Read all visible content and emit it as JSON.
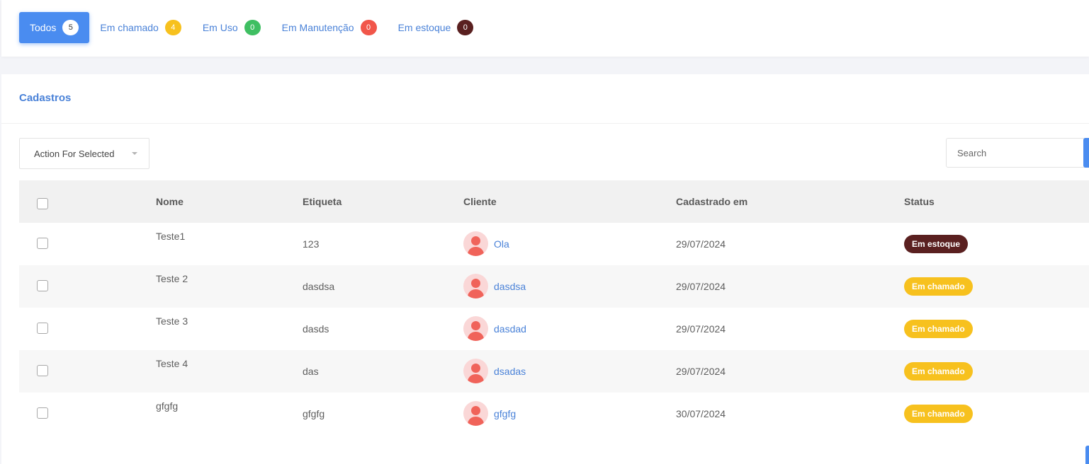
{
  "filters": [
    {
      "label": "Todos",
      "count": "5",
      "color": "#ffffff",
      "active": true
    },
    {
      "label": "Em chamado",
      "count": "4",
      "color": "#f7c11e"
    },
    {
      "label": "Em Uso",
      "count": "0",
      "color": "#3fbf62"
    },
    {
      "label": "Em Manutenção",
      "count": "0",
      "color": "#f1564a"
    },
    {
      "label": "Em estoque",
      "count": "0",
      "color": "#5a2020"
    }
  ],
  "card": {
    "title": "Cadastros"
  },
  "action_select": {
    "label": "Action For Selected"
  },
  "search": {
    "placeholder": "Search"
  },
  "table": {
    "headers": {
      "nome": "Nome",
      "etiqueta": "Etiqueta",
      "cliente": "Cliente",
      "cadastrado": "Cadastrado em",
      "status": "Status"
    },
    "rows": [
      {
        "nome": "Teste1",
        "etiqueta": "123",
        "cliente": "Ola",
        "cadastrado": "29/07/2024",
        "status": "Em estoque",
        "status_color": "#5a2020"
      },
      {
        "nome": "Teste 2",
        "etiqueta": "dasdsa",
        "cliente": "dasdsa",
        "cadastrado": "29/07/2024",
        "status": "Em chamado",
        "status_color": "#f7c11e"
      },
      {
        "nome": "Teste 3",
        "etiqueta": "dasds",
        "cliente": "dasdad",
        "cadastrado": "29/07/2024",
        "status": "Em chamado",
        "status_color": "#f7c11e"
      },
      {
        "nome": "Teste 4",
        "etiqueta": "das",
        "cliente": "dsadas",
        "cadastrado": "29/07/2024",
        "status": "Em chamado",
        "status_color": "#f7c11e"
      },
      {
        "nome": "gfgfg",
        "etiqueta": "gfgfg",
        "cliente": "gfgfg",
        "cadastrado": "30/07/2024",
        "status": "Em chamado",
        "status_color": "#f7c11e"
      }
    ]
  },
  "icons": {
    "avatar": "user-avatar-icon",
    "caret": "caret-down-icon"
  },
  "colors": {
    "accent": "#4a8cf0",
    "link": "#4a82d8"
  }
}
